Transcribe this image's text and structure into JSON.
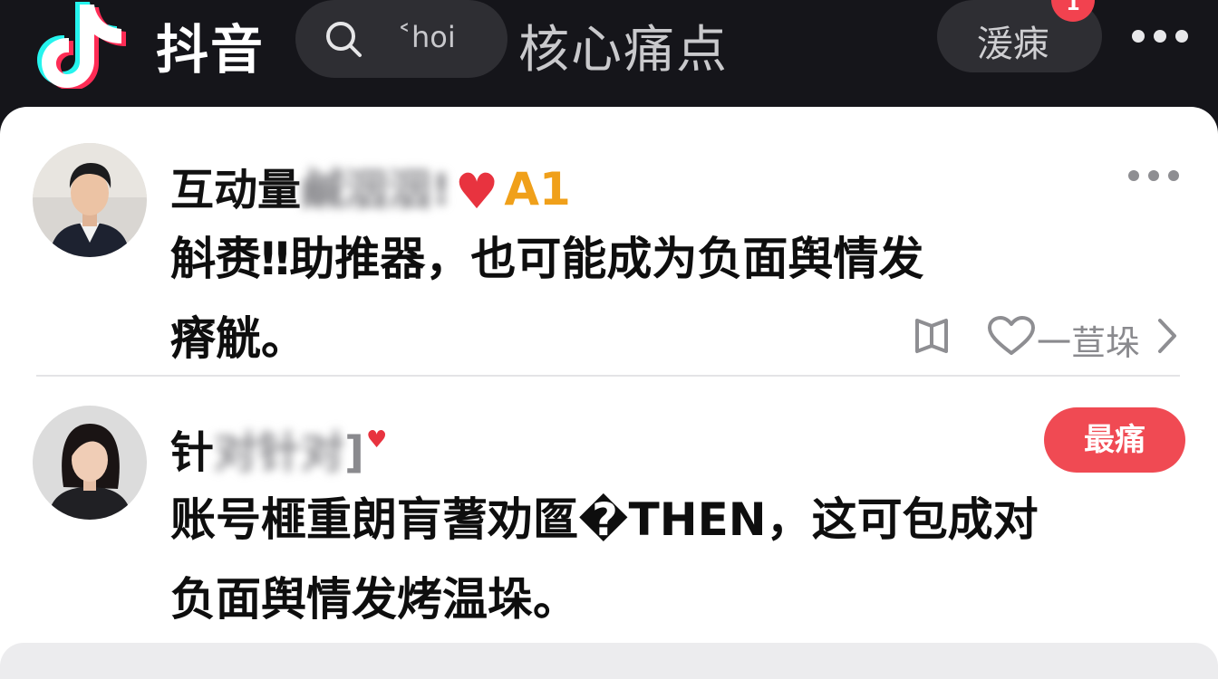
{
  "header": {
    "app_name": "抖音",
    "search_text": "˂hoi",
    "title": "核心痛点",
    "right_button": "湲㾊",
    "notification_count": "1"
  },
  "posts": [
    {
      "name_prefix": "互动量",
      "name_blurred": "鹹洇洇!",
      "tag": "A1",
      "body_line1": "斛赉‼助推器，也可能成为负面舆情发",
      "body_line2": "瘠觥。",
      "action_label": "一荁垛"
    },
    {
      "name_prefix": "针",
      "name_blurred": "对针对",
      "name_suffix": "]",
      "badge": "最痛",
      "body_line1": "账号榧重朗肓蓍劝匫�THEN，这可包成对",
      "body_line2": "负面舆情发烤温垛。"
    }
  ],
  "colors": {
    "accent_red": "#f04a53",
    "tag_orange": "#f0a01a",
    "header_bg": "#15151a",
    "pill_bg": "#2e2e33"
  }
}
